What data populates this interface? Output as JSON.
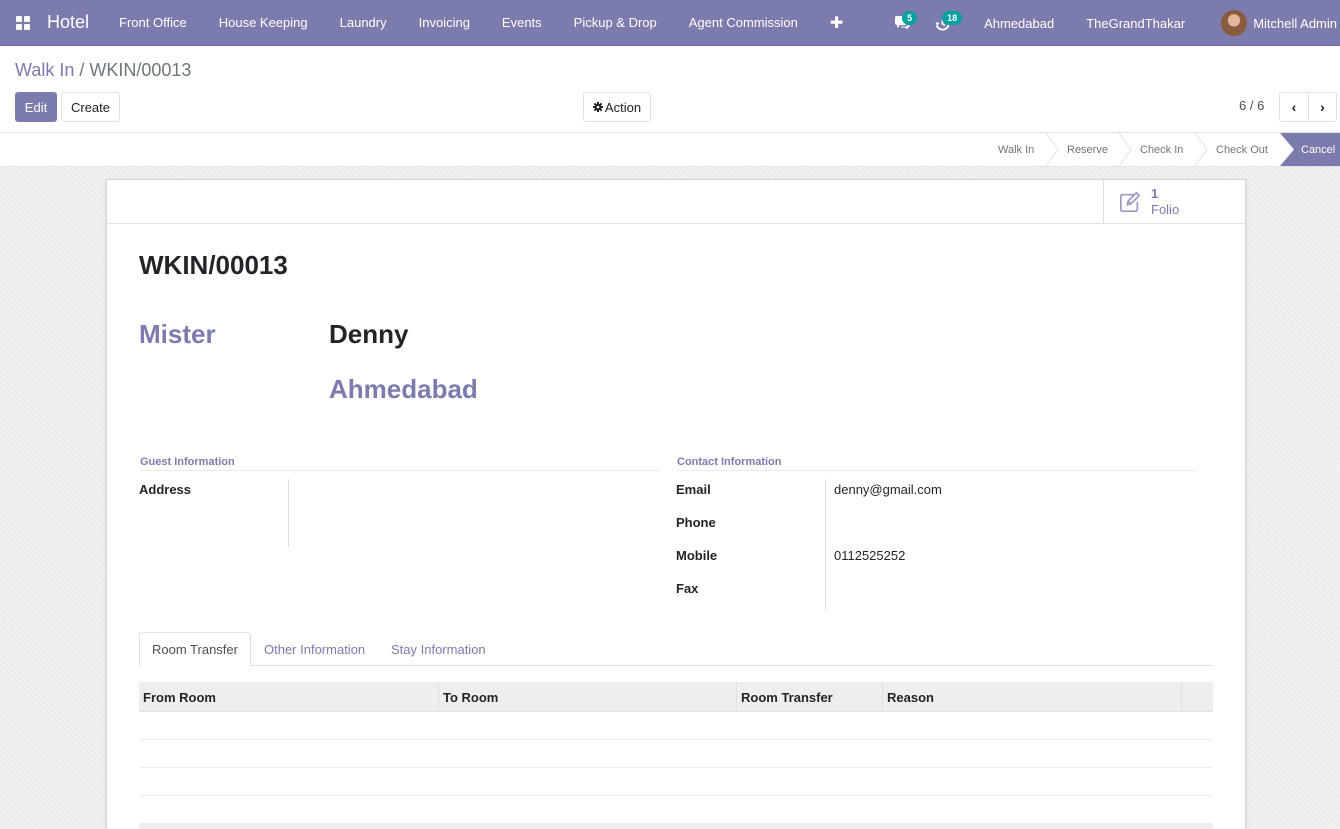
{
  "navbar": {
    "app_name": "Hotel",
    "menu": [
      "Front Office",
      "House Keeping",
      "Laundry",
      "Invoicing",
      "Events",
      "Pickup & Drop",
      "Agent Commission"
    ],
    "plus": "✚",
    "messages_count": "5",
    "activities_count": "18",
    "location": "Ahmedabad",
    "company": "TheGrandThakar",
    "user": "Mitchell Admin"
  },
  "breadcrumb": {
    "parent": "Walk In",
    "separator": "/",
    "current": "WKIN/00013"
  },
  "buttons": {
    "edit": "Edit",
    "create": "Create",
    "action": "Action"
  },
  "pager": {
    "value": "6 / 6"
  },
  "statusbar": {
    "stages": [
      "Walk In",
      "Reserve",
      "Check In",
      "Check Out"
    ],
    "active": "Cancel"
  },
  "smart_button": {
    "value": "1",
    "label": "Folio",
    "icon": "edit-icon"
  },
  "record": {
    "name": "WKIN/00013",
    "title": "Mister",
    "guest_name": "Denny",
    "city": "Ahmedabad"
  },
  "guest_info": {
    "title": "Guest Information",
    "address_label": "Address",
    "address_value": ""
  },
  "contact_info": {
    "title": "Contact Information",
    "email_label": "Email",
    "email_value": "denny@gmail.com",
    "phone_label": "Phone",
    "phone_value": "",
    "mobile_label": "Mobile",
    "mobile_value": "0112525252",
    "fax_label": "Fax",
    "fax_value": ""
  },
  "tabs": [
    "Room Transfer",
    "Other Information",
    "Stay Information"
  ],
  "active_tab": "Room Transfer",
  "table": {
    "columns": [
      "From Room",
      "To Room",
      "Room Transfer",
      "Reason"
    ],
    "rows": []
  },
  "colors": {
    "brand": "#7c7bad",
    "badge": "#00a09d"
  }
}
